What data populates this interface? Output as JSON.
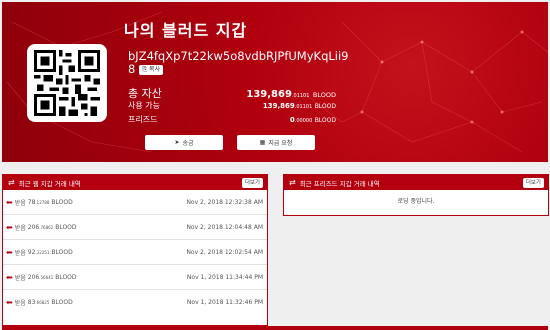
{
  "hero": {
    "title": "나의 블러드 지갑",
    "address": "bJZ4fqXp7t22kw5o8vdbRJPfUMyKqLii98",
    "copy_label": "복사",
    "balances": {
      "total": {
        "label": "총 자산",
        "int": "139,869",
        "dec": ".01101",
        "unit": "BLOOD"
      },
      "available": {
        "label": "사용 가능",
        "int": "139,869",
        "dec": ".01101",
        "unit": "BLOOD"
      },
      "frozen": {
        "label": "프리즈드",
        "int": "0",
        "dec": ".00000",
        "unit": "BLOOD"
      }
    },
    "send_label": "송금",
    "request_label": "지급 요청"
  },
  "web_panel": {
    "title": "최근 웹 지갑 거래 내역",
    "more_label": "더보기",
    "rows": [
      {
        "type": "받음",
        "amount": "78",
        "dec": ".12788",
        "unit": "BLOOD",
        "date": "Nov 2, 2018 12:32:38 AM"
      },
      {
        "type": "받음",
        "amount": "206",
        "dec": ".76862",
        "unit": "BLOOD",
        "date": "Nov 2, 2018 12:04:48 AM"
      },
      {
        "type": "받음",
        "amount": "92",
        "dec": ".32251",
        "unit": "BLOOD",
        "date": "Nov 2, 2018 12:02:54 AM"
      },
      {
        "type": "받음",
        "amount": "206",
        "dec": ".56641",
        "unit": "BLOOD",
        "date": "Nov 1, 2018 11:34:44 PM"
      },
      {
        "type": "받음",
        "amount": "83",
        "dec": ".66825",
        "unit": "BLOOD",
        "date": "Nov 1, 2018 11:32:46 PM"
      }
    ]
  },
  "frozen_panel": {
    "title": "최근 프리즈드 지갑 거래 내역",
    "more_label": "더보기",
    "loading": "로딩 중입니다."
  },
  "colors": {
    "primary": "#b0000e",
    "header": "#b4000e"
  },
  "icons": {
    "transfer": "exchange-icon",
    "send": "paper-plane-icon",
    "request": "qrcode-icon",
    "incoming": "arrow-left-icon"
  }
}
